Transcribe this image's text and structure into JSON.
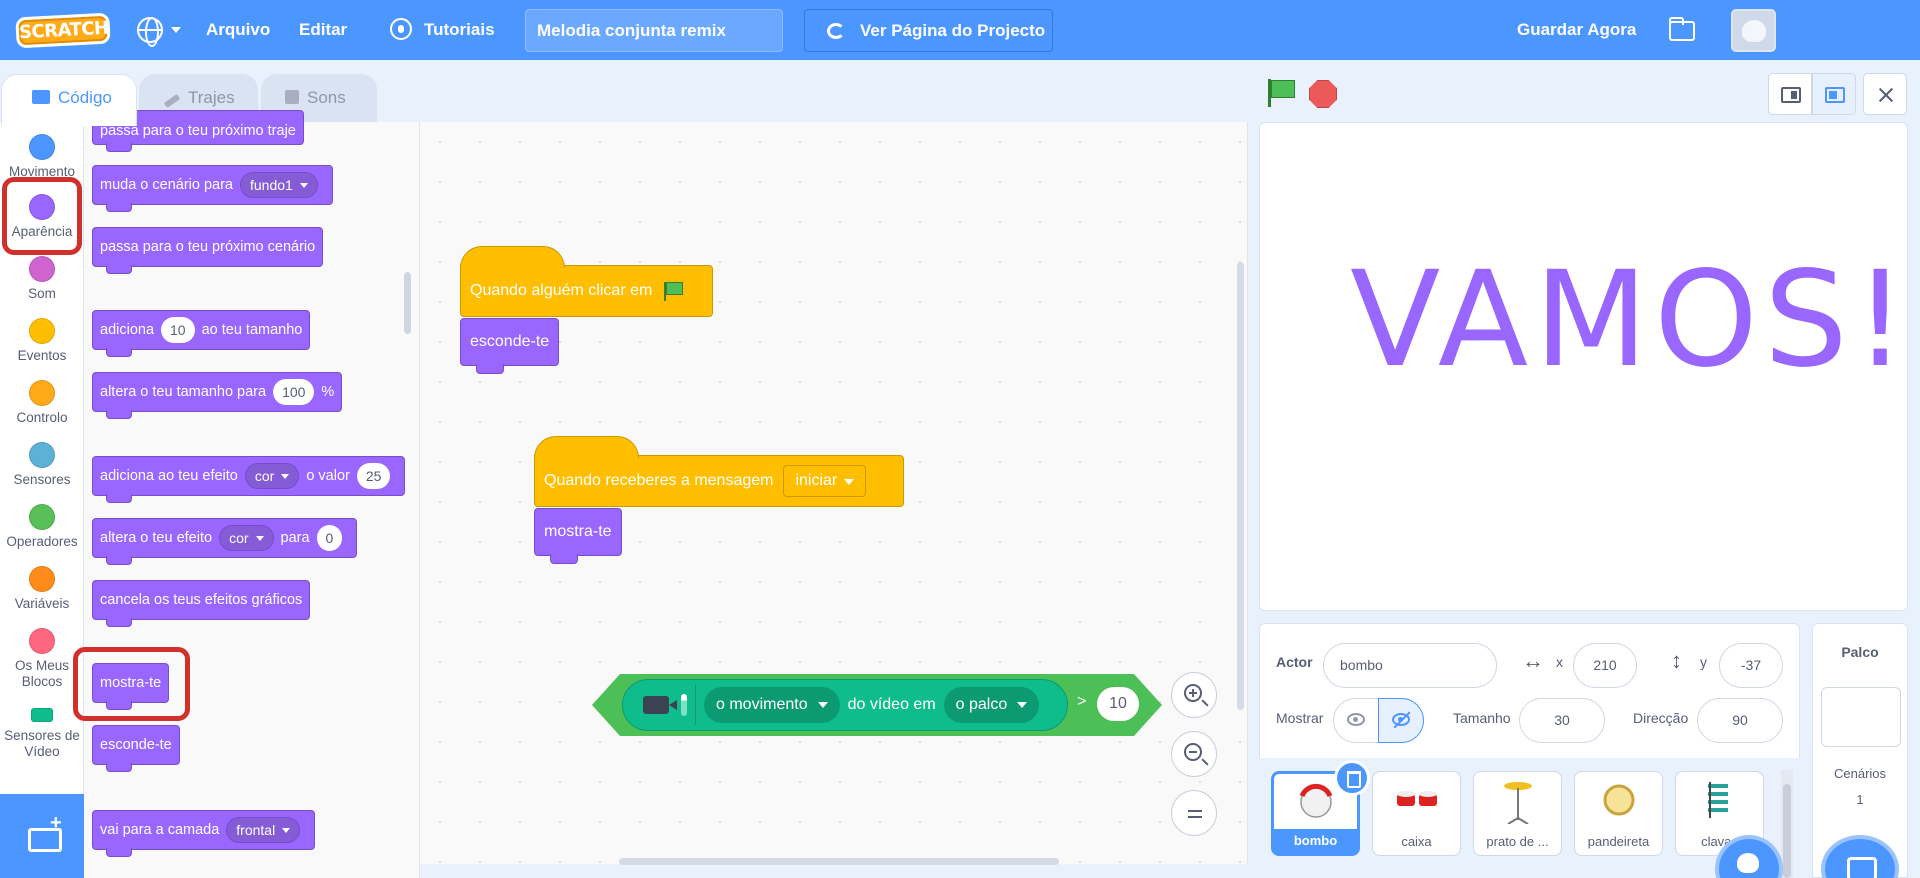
{
  "menu": {
    "logo": "SCRATCH",
    "file": "Arquivo",
    "edit": "Editar",
    "tutorials": "Tutoriais",
    "project_title": "Melodia conjunta remix",
    "project_page": "Ver Página do Projecto",
    "save_now": "Guardar Agora"
  },
  "tabs": {
    "code": "Código",
    "costumes": "Trajes",
    "sounds": "Sons"
  },
  "categories": [
    {
      "label": "Movimento",
      "color": "#4c97ff"
    },
    {
      "label": "Aparência",
      "color": "#9966ff"
    },
    {
      "label": "Som",
      "color": "#cf63cf"
    },
    {
      "label": "Eventos",
      "color": "#ffbf00"
    },
    {
      "label": "Controlo",
      "color": "#ffab19"
    },
    {
      "label": "Sensores",
      "color": "#5cb1d6"
    },
    {
      "label": "Operadores",
      "color": "#59c059"
    },
    {
      "label": "Variáveis",
      "color": "#ff8c1a"
    },
    {
      "label": "Os Meus Blocos",
      "color": "#ff6680"
    },
    {
      "label": "Sensores de Vídeo",
      "color": "#0fbd8c"
    }
  ],
  "palette": {
    "next_costume": "passa para o teu próximo traje",
    "switch_backdrop": "muda o cenário para",
    "backdrop_value": "fundo1",
    "next_backdrop": "passa para o teu próximo cenário",
    "change_size_a": "adiciona",
    "change_size_val": "10",
    "change_size_b": "ao teu tamanho",
    "set_size_a": "altera o teu tamanho para",
    "set_size_val": "100",
    "set_size_b": "%",
    "change_effect_a": "adiciona ao teu efeito",
    "change_effect_drop": "cor",
    "change_effect_b": "o valor",
    "change_effect_val": "25",
    "set_effect_a": "altera o teu efeito",
    "set_effect_drop": "cor",
    "set_effect_b": "para",
    "set_effect_val": "0",
    "clear_effects": "cancela os teus efeitos gráficos",
    "show": "mostra-te",
    "hide": "esconde-te",
    "go_layer": "vai para a camada",
    "go_layer_drop": "frontal"
  },
  "scripts": {
    "hat1": "Quando alguém clicar em",
    "hat1_block": "esconde-te",
    "hat2": "Quando receberes a mensagem",
    "hat2_msg": "iniciar",
    "hat2_block": "mostra-te",
    "video_drop1": "o movimento",
    "video_text": "do vídeo em",
    "video_drop2": "o palco",
    "video_op": ">",
    "video_val": "10"
  },
  "stage": {
    "text": "VAMOS!"
  },
  "sprite_info": {
    "actor_label": "Actor",
    "actor_name": "bombo",
    "x_label": "x",
    "x_value": "210",
    "y_label": "y",
    "y_value": "-37",
    "show_label": "Mostrar",
    "size_label": "Tamanho",
    "size_value": "30",
    "direction_label": "Direcção",
    "direction_value": "90"
  },
  "sprites": [
    "bombo",
    "caixa",
    "prato de ...",
    "pandeireta",
    "clavas"
  ],
  "stage_pane": {
    "title": "Palco",
    "backdrops_label": "Cenários",
    "backdrops_count": "1"
  }
}
